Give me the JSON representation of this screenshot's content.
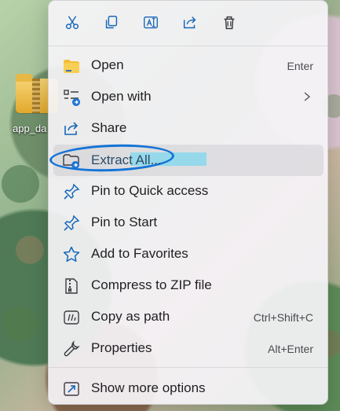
{
  "desktop": {
    "icon_label": "app_da"
  },
  "toolbar": {
    "items": [
      {
        "name": "cut",
        "icon": "scissors-icon"
      },
      {
        "name": "copy",
        "icon": "copy-icon"
      },
      {
        "name": "rename",
        "icon": "rename-icon"
      },
      {
        "name": "share",
        "icon": "share-icon"
      },
      {
        "name": "delete",
        "icon": "trash-icon"
      }
    ]
  },
  "menu": {
    "items": [
      {
        "label": "Open",
        "shortcut": "Enter",
        "icon": "folder-icon"
      },
      {
        "label": "Open with",
        "shortcut": "",
        "icon": "open-with-icon",
        "submenu": true
      },
      {
        "label": "Share",
        "shortcut": "",
        "icon": "share-icon"
      },
      {
        "label": "Extract All...",
        "shortcut": "",
        "icon": "extract-folder-icon",
        "highlighted": true
      },
      {
        "label": "Pin to Quick access",
        "shortcut": "",
        "icon": "pin-icon"
      },
      {
        "label": "Pin to Start",
        "shortcut": "",
        "icon": "pin-icon"
      },
      {
        "label": "Add to Favorites",
        "shortcut": "",
        "icon": "star-icon"
      },
      {
        "label": "Compress to ZIP file",
        "shortcut": "",
        "icon": "zip-file-icon"
      },
      {
        "label": "Copy as path",
        "shortcut": "Ctrl+Shift+C",
        "icon": "copy-path-icon"
      },
      {
        "label": "Properties",
        "shortcut": "Alt+Enter",
        "icon": "wrench-icon"
      },
      {
        "label": "Show more options",
        "shortcut": "",
        "icon": "more-options-icon"
      }
    ]
  },
  "colors": {
    "menu_background": "#f6f4f8",
    "accent": "#1473d6",
    "highlight": "#95d9ea"
  }
}
